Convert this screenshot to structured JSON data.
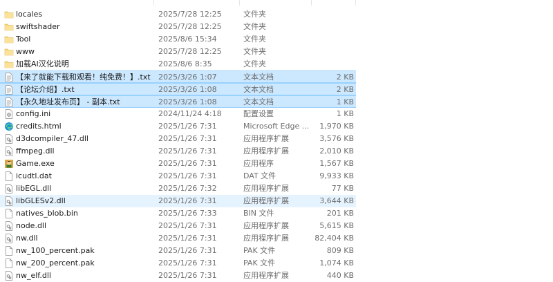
{
  "files": [
    {
      "name": "locales",
      "date": "2025/7/28 12:25",
      "type": "文件夹",
      "size": "",
      "icon": "folder-icon",
      "state": ""
    },
    {
      "name": "swiftshader",
      "date": "2025/7/28 12:25",
      "type": "文件夹",
      "size": "",
      "icon": "folder-icon",
      "state": ""
    },
    {
      "name": "Tool",
      "date": "2025/8/6 15:34",
      "type": "文件夹",
      "size": "",
      "icon": "folder-icon",
      "state": ""
    },
    {
      "name": "www",
      "date": "2025/7/28 12:25",
      "type": "文件夹",
      "size": "",
      "icon": "folder-icon",
      "state": ""
    },
    {
      "name": "加载AI汉化说明",
      "date": "2025/8/6 8:35",
      "type": "文件夹",
      "size": "",
      "icon": "folder-icon",
      "state": ""
    },
    {
      "name": "【来了就能下载和观看！纯免费！】.txt",
      "date": "2025/3/26 1:07",
      "type": "文本文档",
      "size": "2 KB",
      "icon": "text-file-icon",
      "state": "selected"
    },
    {
      "name": "【论坛介绍】.txt",
      "date": "2025/3/26 1:08",
      "type": "文本文档",
      "size": "2 KB",
      "icon": "text-file-icon",
      "state": "selected"
    },
    {
      "name": "【永久地址发布页】 - 副本.txt",
      "date": "2025/3/26 1:08",
      "type": "文本文档",
      "size": "1 KB",
      "icon": "text-file-icon",
      "state": "selected"
    },
    {
      "name": "config.ini",
      "date": "2024/11/24 4:18",
      "type": "配置设置",
      "size": "1 KB",
      "icon": "config-file-icon",
      "state": ""
    },
    {
      "name": "credits.html",
      "date": "2025/1/26 7:31",
      "type": "Microsoft Edge ...",
      "size": "1,970 KB",
      "icon": "edge-icon",
      "state": ""
    },
    {
      "name": "d3dcompiler_47.dll",
      "date": "2025/1/26 7:31",
      "type": "应用程序扩展",
      "size": "3,576 KB",
      "icon": "dll-file-icon",
      "state": ""
    },
    {
      "name": "ffmpeg.dll",
      "date": "2025/1/26 7:31",
      "type": "应用程序扩展",
      "size": "2,010 KB",
      "icon": "dll-file-icon",
      "state": ""
    },
    {
      "name": "Game.exe",
      "date": "2025/1/26 7:31",
      "type": "应用程序",
      "size": "1,567 KB",
      "icon": "game-exe-icon",
      "state": ""
    },
    {
      "name": "icudtl.dat",
      "date": "2025/1/26 7:31",
      "type": "DAT 文件",
      "size": "9,933 KB",
      "icon": "file-icon",
      "state": ""
    },
    {
      "name": "libEGL.dll",
      "date": "2025/1/26 7:32",
      "type": "应用程序扩展",
      "size": "77 KB",
      "icon": "dll-file-icon",
      "state": ""
    },
    {
      "name": "libGLESv2.dll",
      "date": "2025/1/26 7:31",
      "type": "应用程序扩展",
      "size": "3,644 KB",
      "icon": "dll-file-icon",
      "state": "hover"
    },
    {
      "name": "natives_blob.bin",
      "date": "2025/1/26 7:33",
      "type": "BIN 文件",
      "size": "201 KB",
      "icon": "file-icon",
      "state": ""
    },
    {
      "name": "node.dll",
      "date": "2025/1/26 7:31",
      "type": "应用程序扩展",
      "size": "5,615 KB",
      "icon": "dll-file-icon",
      "state": ""
    },
    {
      "name": "nw.dll",
      "date": "2025/1/26 7:31",
      "type": "应用程序扩展",
      "size": "82,404 KB",
      "icon": "dll-file-icon",
      "state": ""
    },
    {
      "name": "nw_100_percent.pak",
      "date": "2025/1/26 7:31",
      "type": "PAK 文件",
      "size": "809 KB",
      "icon": "file-icon",
      "state": ""
    },
    {
      "name": "nw_200_percent.pak",
      "date": "2025/1/26 7:31",
      "type": "PAK 文件",
      "size": "1,074 KB",
      "icon": "file-icon",
      "state": ""
    },
    {
      "name": "nw_elf.dll",
      "date": "2025/1/26 7:31",
      "type": "应用程序扩展",
      "size": "440 KB",
      "icon": "dll-file-icon",
      "state": ""
    }
  ],
  "colors": {
    "selected_bg": "#cce8ff",
    "hover_bg": "#e5f3ff",
    "folder": "#f8d775",
    "edge": "#1b8fd8"
  }
}
